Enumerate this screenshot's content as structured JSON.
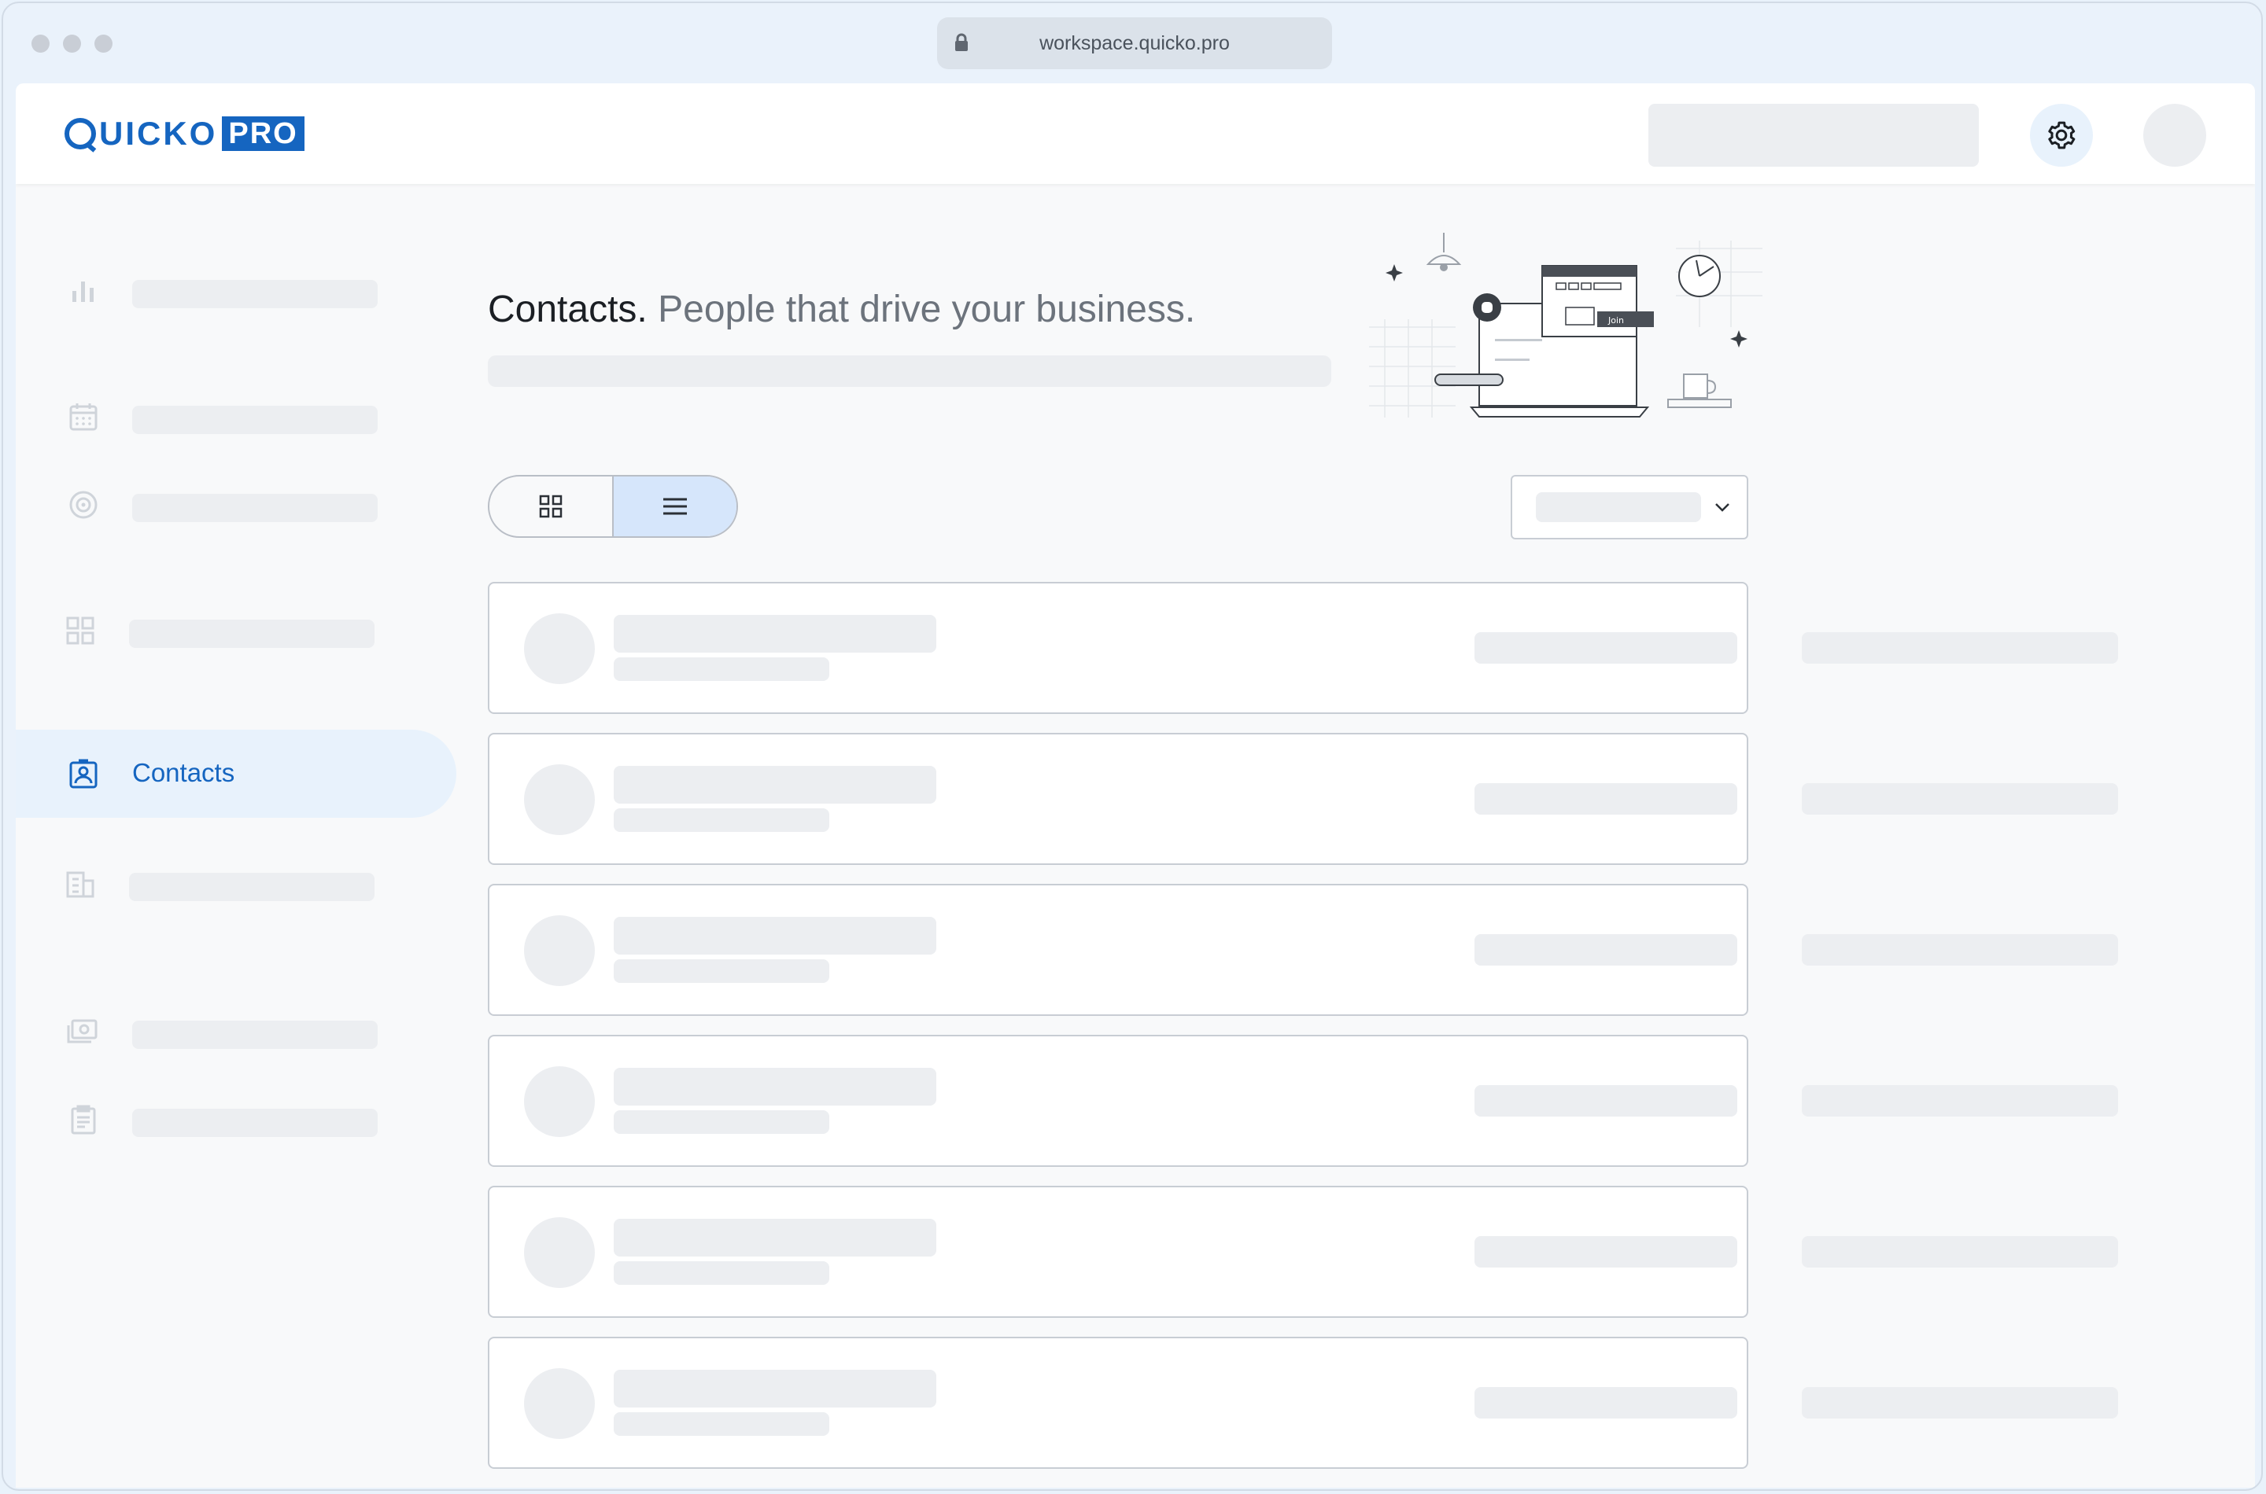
{
  "browser": {
    "url": "workspace.quicko.pro"
  },
  "brand": {
    "name_part1": "UICKO",
    "name_part2": "PRO",
    "color": "#1565c0"
  },
  "header": {
    "settings_icon": "gear-icon"
  },
  "sidebar": {
    "items": [
      {
        "icon": "bar-chart-icon",
        "label": ""
      },
      {
        "icon": "calendar-icon",
        "label": ""
      },
      {
        "icon": "target-icon",
        "label": ""
      },
      {
        "icon": "grid-icon",
        "label": ""
      },
      {
        "icon": "contact-badge-icon",
        "label": "Contacts",
        "active": true
      },
      {
        "icon": "building-icon",
        "label": ""
      },
      {
        "icon": "money-icon",
        "label": ""
      },
      {
        "icon": "clipboard-icon",
        "label": ""
      }
    ]
  },
  "main": {
    "title": "Contacts.",
    "subtitle": "People that drive your business.",
    "illustration_button": "Join",
    "view_toggle": {
      "options": [
        "grid-view",
        "list-view"
      ],
      "selected": "list-view"
    },
    "contact_rows": 6
  },
  "colors": {
    "accent": "#1565c0",
    "active_bg": "#e8f2fc",
    "skeleton": "#eceef1"
  }
}
